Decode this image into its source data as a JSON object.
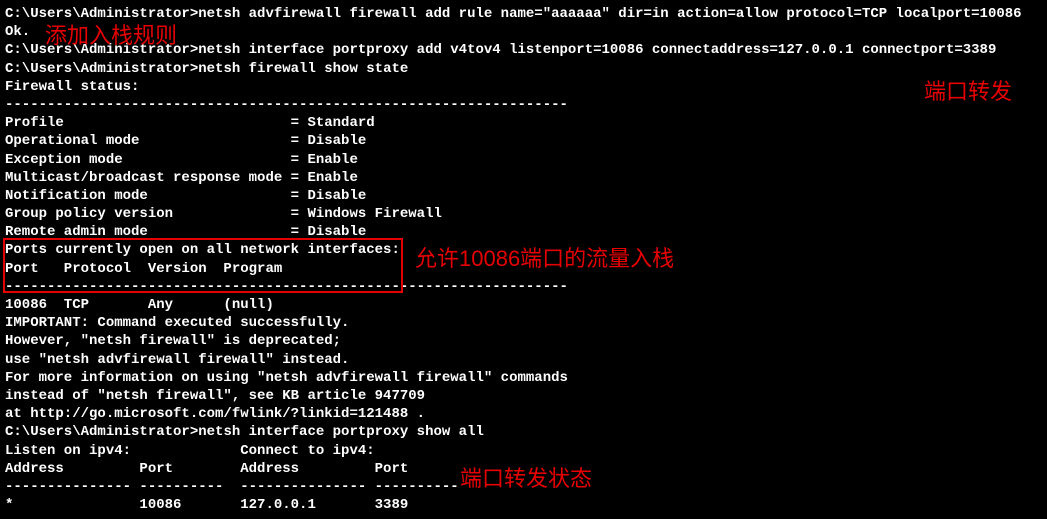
{
  "annotations": {
    "a1": "添加入栈规则",
    "a2": "端口转发",
    "a3": "允许10086端口的流量入栈",
    "a4": "端口转发状态"
  },
  "prompt_prefix": "C:\\Users\\Administrator>",
  "cmd1": "netsh advfirewall firewall add rule name=\"aaaaaa\" dir=in action=allow protocol=TCP localport=10086",
  "cmd1_result": "Ok.",
  "cmd2": "netsh interface portproxy add v4tov4 listenport=10086 connectaddress=127.0.0.1 connectport=3389",
  "cmd3": "netsh firewall show state",
  "fw_status_header": "Firewall status:",
  "dashes_short": "-------------------------------------------------------------------",
  "fw_rows": {
    "r1": "Profile                           = Standard",
    "r2": "Operational mode                  = Disable",
    "r3": "Exception mode                    = Enable",
    "r4": "Multicast/broadcast response mode = Enable",
    "r5": "Notification mode                 = Disable",
    "r6": "Group policy version              = Windows Firewall",
    "r7": "Remote admin mode                 = Disable"
  },
  "ports_header": "Ports currently open on all network interfaces:",
  "ports_cols": "Port   Protocol  Version  Program",
  "dashes_long": "-------------------------------------------------------------------",
  "ports_row": "10086  TCP       Any      (null)",
  "important1": "IMPORTANT: Command executed successfully.",
  "important2": "However, \"netsh firewall\" is deprecated;",
  "important3": "use \"netsh advfirewall firewall\" instead.",
  "important4": "For more information on using \"netsh advfirewall firewall\" commands",
  "important5": "instead of \"netsh firewall\", see KB article 947709",
  "important6": "at http://go.microsoft.com/fwlink/?linkid=121488 .",
  "cmd4": "netsh interface portproxy show all",
  "pp_header": "Listen on ipv4:             Connect to ipv4:",
  "pp_cols": "Address         Port        Address         Port",
  "pp_dashes": "--------------- ----------  --------------- ----------",
  "pp_row": "*               10086       127.0.0.1       3389",
  "blank": ""
}
